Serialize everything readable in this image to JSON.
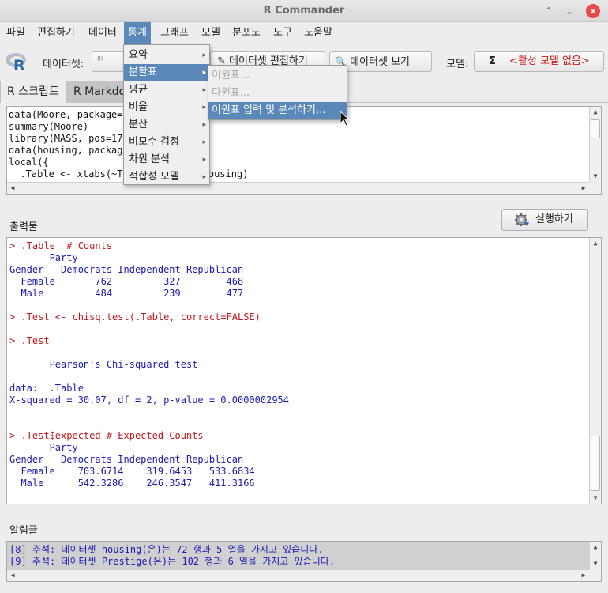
{
  "window": {
    "title": "R Commander"
  },
  "menubar": [
    "파일",
    "편집하기",
    "데이터",
    "통계",
    "그래프",
    "모델",
    "분포도",
    "도구",
    "도움말"
  ],
  "toolbar": {
    "dataset_label": "데이터셋:",
    "dataset_value": "",
    "edit_label": "데이터셋 편집하기",
    "view_label": "데이터셋 보기",
    "model_label": "모델:",
    "model_sigma": "Σ",
    "model_value": "<활성 모델 없음>"
  },
  "tabs": {
    "script": "R 스크립트",
    "markdown": "R Markdown"
  },
  "script_lines": [
    "data(Moore, package=\"carData\")",
    "summary(Moore)",
    "library(MASS, pos=17)",
    "data(housing, package=\"MASS\")",
    "local({",
    "  .Table <- xtabs(~Type+Sat, data=housing)",
    "  ..."
  ],
  "output": {
    "label": "출력물",
    "run_label": "실행하기",
    "lines": [
      {
        "t": "cmd",
        "s": "> .Table  # Counts"
      },
      {
        "t": "res",
        "s": "       Party"
      },
      {
        "t": "res",
        "s": "Gender   Democrats Independent Republican"
      },
      {
        "t": "res",
        "s": "  Female       762         327        468"
      },
      {
        "t": "res",
        "s": "  Male         484         239        477"
      },
      {
        "t": "res",
        "s": ""
      },
      {
        "t": "cmd",
        "s": "> .Test <- chisq.test(.Table, correct=FALSE)"
      },
      {
        "t": "res",
        "s": ""
      },
      {
        "t": "cmd",
        "s": "> .Test"
      },
      {
        "t": "res",
        "s": ""
      },
      {
        "t": "res",
        "s": "       Pearson's Chi-squared test"
      },
      {
        "t": "res",
        "s": ""
      },
      {
        "t": "res",
        "s": "data:  .Table"
      },
      {
        "t": "res",
        "s": "X-squared = 30.07, df = 2, p-value = 0.0000002954"
      },
      {
        "t": "res",
        "s": ""
      },
      {
        "t": "res",
        "s": ""
      },
      {
        "t": "cmd",
        "s": "> .Test$expected # Expected Counts"
      },
      {
        "t": "res",
        "s": "       Party"
      },
      {
        "t": "res",
        "s": "Gender   Democrats Independent Republican"
      },
      {
        "t": "res",
        "s": "  Female    703.6714    319.6453   533.6834"
      },
      {
        "t": "res",
        "s": "  Male      542.3286    246.3547   411.3166"
      }
    ]
  },
  "messages": {
    "label": "알림글",
    "lines": [
      "[8] 주석: 데이터셋 housing(은)는 72 행과 5 열을 가지고 있습니다.",
      "[9] 주석: 데이터셋 Prestige(은)는 102 행과 6 열을 가지고 있습니다."
    ]
  },
  "stats_menu": {
    "items": [
      "요약",
      "분할표",
      "평균",
      "비율",
      "분산",
      "비모수 검정",
      "차원 분석",
      "적합성 모델"
    ],
    "submenu_arrow": "▸"
  },
  "contingency_submenu": {
    "items": [
      "이원표...",
      "다원표...",
      "이원표 입력 및 분석하기..."
    ]
  },
  "colors": {
    "menu_highlight": "#5a88b8",
    "command_text": "#c0181c",
    "result_text": "#1a1ab0",
    "no_model_text": "#d01818"
  }
}
